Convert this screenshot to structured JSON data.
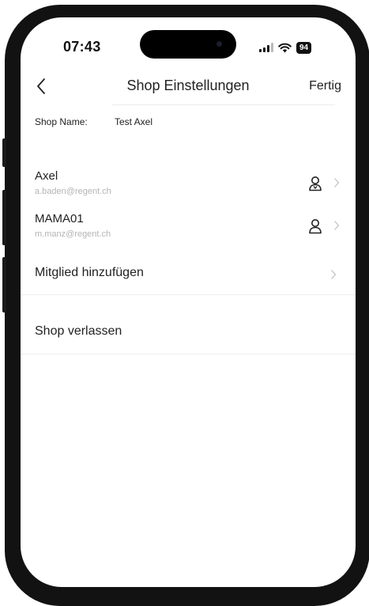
{
  "status_bar": {
    "time": "07:43",
    "battery": "94"
  },
  "nav": {
    "title": "Shop Einstellungen",
    "done_label": "Fertig"
  },
  "shop_name": {
    "label": "Shop Name:",
    "value": "Test Axel"
  },
  "members": [
    {
      "name": "Axel",
      "email": "a.baden@regent.ch",
      "role_icon": "owner-person-icon"
    },
    {
      "name": "MAMA01",
      "email": "m.manz@regent.ch",
      "role_icon": "person-icon"
    }
  ],
  "actions": {
    "add_member": "Mitglied hinzufügen",
    "leave_shop": "Shop verlassen"
  }
}
